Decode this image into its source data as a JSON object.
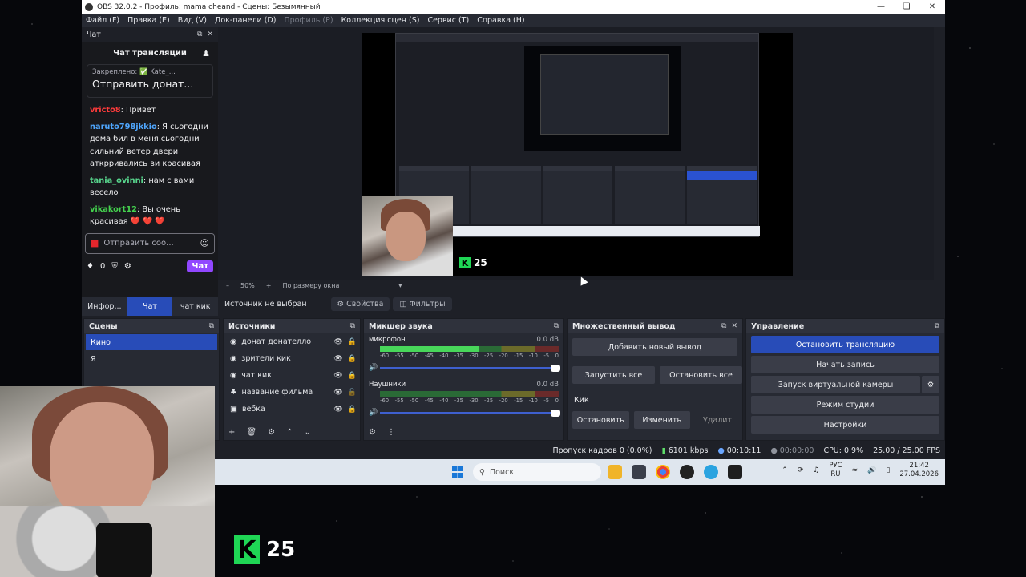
{
  "window": {
    "title": "OBS 32.0.2 - Профиль: mama cheand - Сцены: Безымянный"
  },
  "menu": [
    "Файл (F)",
    "Правка (E)",
    "Вид (V)",
    "Док-панели (D)",
    "Профиль (P)",
    "Коллекция сцен (S)",
    "Сервис (T)",
    "Справка (H)"
  ],
  "chat": {
    "dock_title": "Чат",
    "header": "Чат трансляции",
    "pinned_small": "Закреплено: ✅ Kate_...",
    "pinned_big": "Отправить донат...",
    "messages": [
      {
        "user": "vricto8",
        "text": ": Привет",
        "cls": "u1"
      },
      {
        "user": "naruto798jkkio",
        "text": ": Я сьогодни дома бил в меня сьогодни сильний ветер двери аткрривались ви красивая",
        "cls": "u2"
      },
      {
        "user": "tania_ovinni",
        "text": ": нам с вами весело",
        "cls": "u3"
      },
      {
        "user": "vikakort12",
        "text": ": Вы очень красивая",
        "cls": "u4"
      }
    ],
    "hearts": "❤️ ❤️ ❤️",
    "input_placeholder": "Отправить соо...",
    "points": "0",
    "chat_button": "Чат",
    "tabs": [
      "Инфор...",
      "Чат",
      "чат кик"
    ]
  },
  "preview": {
    "zoom": "50%",
    "fit": "По размеру окна",
    "k_badge": "25"
  },
  "source_bar": {
    "label": "Источник не выбран",
    "properties": "Свойства",
    "filters": "Фильтры"
  },
  "scenes": {
    "title": "Сцены",
    "items": [
      "Кино",
      "Я"
    ]
  },
  "sources": {
    "title": "Источники",
    "items": [
      "донат донателло",
      "зрители кик",
      "чат кик",
      "название фильма",
      "вебка"
    ]
  },
  "mixer": {
    "title": "Микшер звука",
    "channels": [
      {
        "name": "микрофон",
        "db": "0.0 dB",
        "level": 0.55
      },
      {
        "name": "Наушники",
        "db": "0.0 dB",
        "level": 0.0
      }
    ],
    "ticks": [
      "-60",
      "-55",
      "-50",
      "-45",
      "-40",
      "-35",
      "-30",
      "-25",
      "-20",
      "-15",
      "-10",
      "-5",
      "0"
    ]
  },
  "multi": {
    "title": "Множественный вывод",
    "add": "Добавить новый вывод",
    "start_all": "Запустить все",
    "stop_all": "Остановить все",
    "target": "Кик",
    "stop": "Остановить",
    "edit": "Изменить",
    "delete": "Удалит"
  },
  "control": {
    "title": "Управление",
    "stop_stream": "Остановить трансляцию",
    "start_record": "Начать запись",
    "virtual_cam": "Запуск виртуальной камеры",
    "studio": "Режим студии",
    "settings": "Настройки"
  },
  "status": {
    "dropped": "Пропуск кадров 0 (0.0%)",
    "bitrate": "6101 kbps",
    "stream_time": "00:10:11",
    "rec_time": "00:00:00",
    "cpu": "CPU: 0.9%",
    "fps": "25.00 / 25.00 FPS"
  },
  "taskbar": {
    "search": "Поиск",
    "lang_top": "РУС",
    "lang_bottom": "RU",
    "time": "21:42",
    "date": "27.04.2026"
  },
  "overlay": {
    "k_badge": "25"
  }
}
